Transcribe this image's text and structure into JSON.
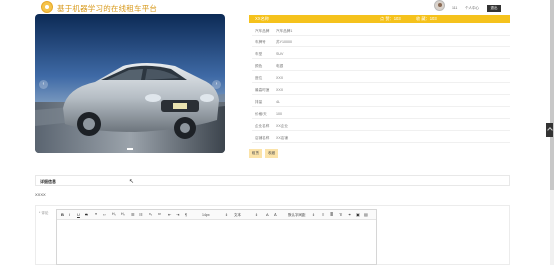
{
  "header": {
    "site_title": "基于机器学习的在线租车平台",
    "user_name": "111",
    "user_center": "个人中心",
    "logout_label": "退出"
  },
  "product": {
    "name": "XX名称",
    "stat1": "点 赞：103",
    "stat2": "收 藏：103",
    "rows": [
      {
        "label": "汽车品牌",
        "value": "汽车品牌1"
      },
      {
        "label": "车牌号",
        "value": "苏Y10000"
      },
      {
        "label": "车型",
        "value": "SUV"
      },
      {
        "label": "颜色",
        "value": "电银"
      },
      {
        "label": "座位",
        "value": "XXX"
      },
      {
        "label": "最高时速",
        "value": "XXX"
      },
      {
        "label": "排量",
        "value": "4L"
      },
      {
        "label": "价格/天",
        "value": "100"
      },
      {
        "label": "企业名称",
        "value": "XX企业"
      },
      {
        "label": "店铺名称",
        "value": "XX店铺"
      }
    ],
    "rent_label": "租赁",
    "favorite_label": "收藏"
  },
  "details": {
    "section_title": "详细信息",
    "text": "XXXX"
  },
  "editor": {
    "label": "* 评论",
    "font_size_label": "14px",
    "font_family_label": "文本",
    "letter_spacing_label": "默认字间距"
  },
  "colors": {
    "accent": "#f5c21c",
    "button_bg": "#fbe3a9",
    "title_color": "#d89a1c"
  }
}
